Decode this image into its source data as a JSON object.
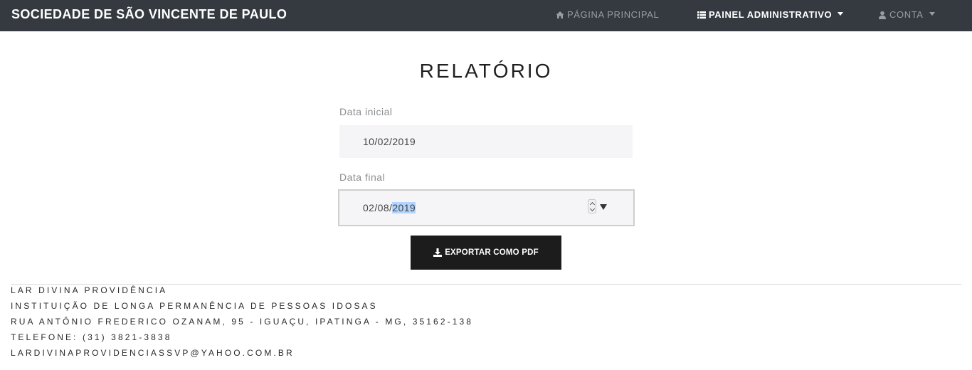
{
  "navbar": {
    "brand": "SOCIEDADE DE SÃO VINCENTE DE PAULO",
    "home_label": "PÁGINA PRINCIPAL",
    "admin_label": "PAINEL ADMINISTRATIVO",
    "account_label": "CONTA",
    "home_icon": "home-icon",
    "admin_icon": "list-icon",
    "account_icon": "user-icon"
  },
  "main": {
    "title": "RELATÓRIO",
    "start_date": {
      "label": "Data inicial",
      "value": "10/02/2019"
    },
    "end_date": {
      "label": "Data final",
      "value_prefix": "02/08/",
      "value_selected": "2019"
    },
    "export_button": {
      "label": "EXPORTAR COMO PDF",
      "icon": "download-icon"
    }
  },
  "footer": {
    "lines": [
      "LAR DIVINA PROVIDÊNCIA",
      "INSTITUIÇÃO DE LONGA PERMANÊNCIA DE PESSOAS IDOSAS",
      "RUA ANTÔNIO FREDERICO OZANAM, 95 - IGUAÇU, IPATINGA - MG, 35162-138",
      "TELEFONE: (31) 3821-3838",
      "LARDIVINAPROVIDENCIASSVP@YAHOO.COM.BR"
    ]
  },
  "colors": {
    "navbar_bg": "#343a40",
    "button_bg": "#1c1c1c",
    "input_bg": "#f5f5f7",
    "selection": "#b3d4fc"
  }
}
